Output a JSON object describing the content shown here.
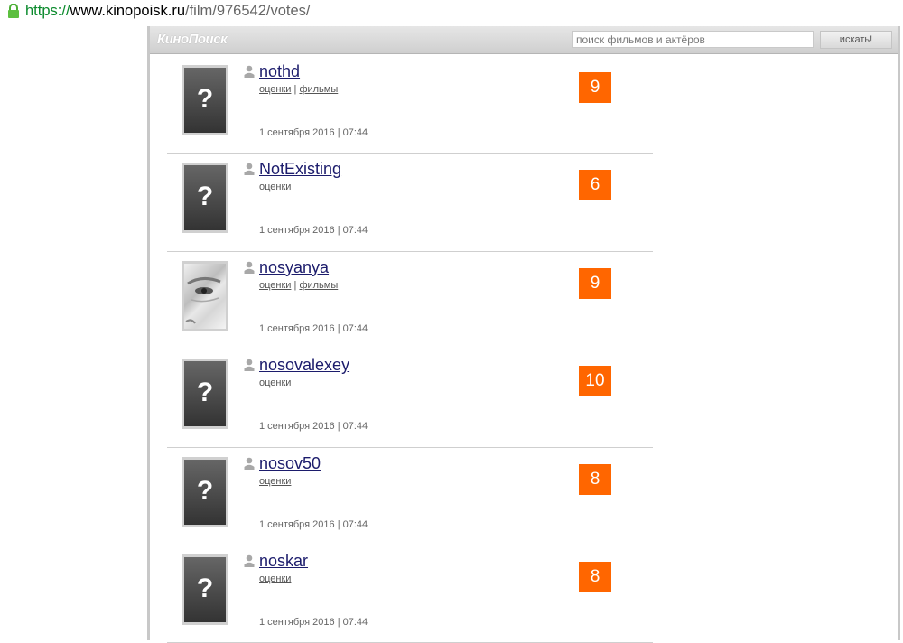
{
  "browser": {
    "url_protocol": "https://",
    "url_host": "www.kinopoisk.ru",
    "url_path": "/film/976542/votes/"
  },
  "header": {
    "logo": "КиноПоиск",
    "search_placeholder": "поиск фильмов и актёров",
    "search_button": "искать!"
  },
  "colors": {
    "score_bg": "#ff6600",
    "username": "#1c1c6c"
  },
  "votes": [
    {
      "username": "nothd",
      "link_ratings": "оценки",
      "separator": "|",
      "link_films": "фильмы",
      "date": "1 сентября 2016 | 07:44",
      "score": "9",
      "avatar": "placeholder",
      "avatar_glyph": "?"
    },
    {
      "username": "NotExisting",
      "link_ratings": "оценки",
      "date": "1 сентября 2016 | 07:44",
      "score": "6",
      "avatar": "placeholder",
      "avatar_glyph": "?"
    },
    {
      "username": "nosyanya",
      "link_ratings": "оценки",
      "separator": "|",
      "link_films": "фильмы",
      "date": "1 сентября 2016 | 07:44",
      "score": "9",
      "avatar": "photo"
    },
    {
      "username": "nosovalexey",
      "link_ratings": "оценки",
      "date": "1 сентября 2016 | 07:44",
      "score": "10",
      "avatar": "placeholder",
      "avatar_glyph": "?"
    },
    {
      "username": "nosov50",
      "link_ratings": "оценки",
      "date": "1 сентября 2016 | 07:44",
      "score": "8",
      "avatar": "placeholder",
      "avatar_glyph": "?"
    },
    {
      "username": "noskar",
      "link_ratings": "оценки",
      "date": "1 сентября 2016 | 07:44",
      "score": "8",
      "avatar": "placeholder",
      "avatar_glyph": "?"
    }
  ]
}
